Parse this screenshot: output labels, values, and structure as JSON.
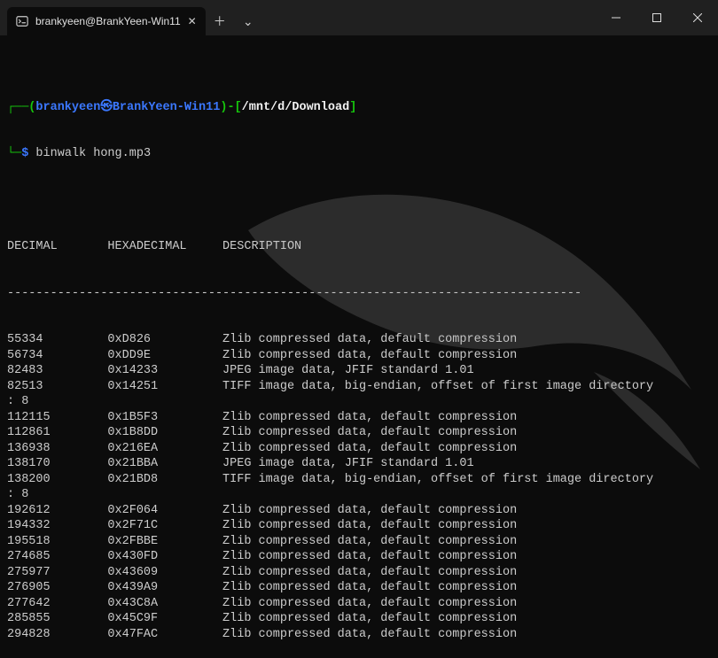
{
  "tab": {
    "title": "brankyeen@BrankYeen-Win11"
  },
  "prompt": {
    "user": "brankyeen",
    "at": "㉿",
    "host": "BrankYeen-Win11",
    "path": "/mnt/d/Download",
    "symbol": "$",
    "command": "binwalk hong.mp3"
  },
  "headers": {
    "decimal": "DECIMAL",
    "hex": "HEXADECIMAL",
    "desc": "DESCRIPTION"
  },
  "sep": "--------------------------------------------------------------------------------",
  "rows": [
    {
      "dec": "55334",
      "hex": "0xD826",
      "desc": "Zlib compressed data, default compression"
    },
    {
      "dec": "56734",
      "hex": "0xDD9E",
      "desc": "Zlib compressed data, default compression"
    },
    {
      "dec": "82483",
      "hex": "0x14233",
      "desc": "JPEG image data, JFIF standard 1.01"
    },
    {
      "dec": "82513",
      "hex": "0x14251",
      "desc": "TIFF image data, big-endian, offset of first image directory",
      "cont": ": 8"
    },
    {
      "dec": "112115",
      "hex": "0x1B5F3",
      "desc": "Zlib compressed data, default compression"
    },
    {
      "dec": "112861",
      "hex": "0x1B8DD",
      "desc": "Zlib compressed data, default compression"
    },
    {
      "dec": "136938",
      "hex": "0x216EA",
      "desc": "Zlib compressed data, default compression"
    },
    {
      "dec": "138170",
      "hex": "0x21BBA",
      "desc": "JPEG image data, JFIF standard 1.01"
    },
    {
      "dec": "138200",
      "hex": "0x21BD8",
      "desc": "TIFF image data, big-endian, offset of first image directory",
      "cont": ": 8"
    },
    {
      "dec": "192612",
      "hex": "0x2F064",
      "desc": "Zlib compressed data, default compression"
    },
    {
      "dec": "194332",
      "hex": "0x2F71C",
      "desc": "Zlib compressed data, default compression"
    },
    {
      "dec": "195518",
      "hex": "0x2FBBE",
      "desc": "Zlib compressed data, default compression"
    },
    {
      "dec": "274685",
      "hex": "0x430FD",
      "desc": "Zlib compressed data, default compression"
    },
    {
      "dec": "275977",
      "hex": "0x43609",
      "desc": "Zlib compressed data, default compression"
    },
    {
      "dec": "276905",
      "hex": "0x439A9",
      "desc": "Zlib compressed data, default compression"
    },
    {
      "dec": "277642",
      "hex": "0x43C8A",
      "desc": "Zlib compressed data, default compression"
    },
    {
      "dec": "285855",
      "hex": "0x45C9F",
      "desc": "Zlib compressed data, default compression"
    },
    {
      "dec": "294828",
      "hex": "0x47FAC",
      "desc": "Zlib compressed data, default compression"
    }
  ]
}
